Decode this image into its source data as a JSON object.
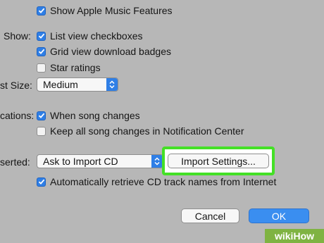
{
  "preferences": {
    "apple_music": {
      "label": "Show Apple Music Features",
      "checked": true
    },
    "show_label": "Show:",
    "show_options": [
      {
        "label": "List view checkboxes",
        "checked": true
      },
      {
        "label": "Grid view download badges",
        "checked": true
      },
      {
        "label": "Star ratings",
        "checked": false
      }
    ],
    "list_size_label": "st Size:",
    "list_size_value": "Medium",
    "notifications_label": "cations:",
    "notification_options": [
      {
        "label": "When song changes",
        "checked": true
      },
      {
        "label": "Keep all song changes in Notification Center",
        "checked": false
      }
    ],
    "cd_label": "serted:",
    "cd_action_value": "Ask to Import CD",
    "import_settings_label": "Import Settings...",
    "auto_retrieve": {
      "label": "Automatically retrieve CD track names from Internet",
      "checked": true
    }
  },
  "footer": {
    "cancel_label": "Cancel",
    "ok_label": "OK"
  },
  "watermark": {
    "prefix": "wiki",
    "suffix": "How"
  },
  "colors": {
    "accent": "#2f7fe6",
    "highlight": "#44e026",
    "background": "#b7b7b7"
  }
}
